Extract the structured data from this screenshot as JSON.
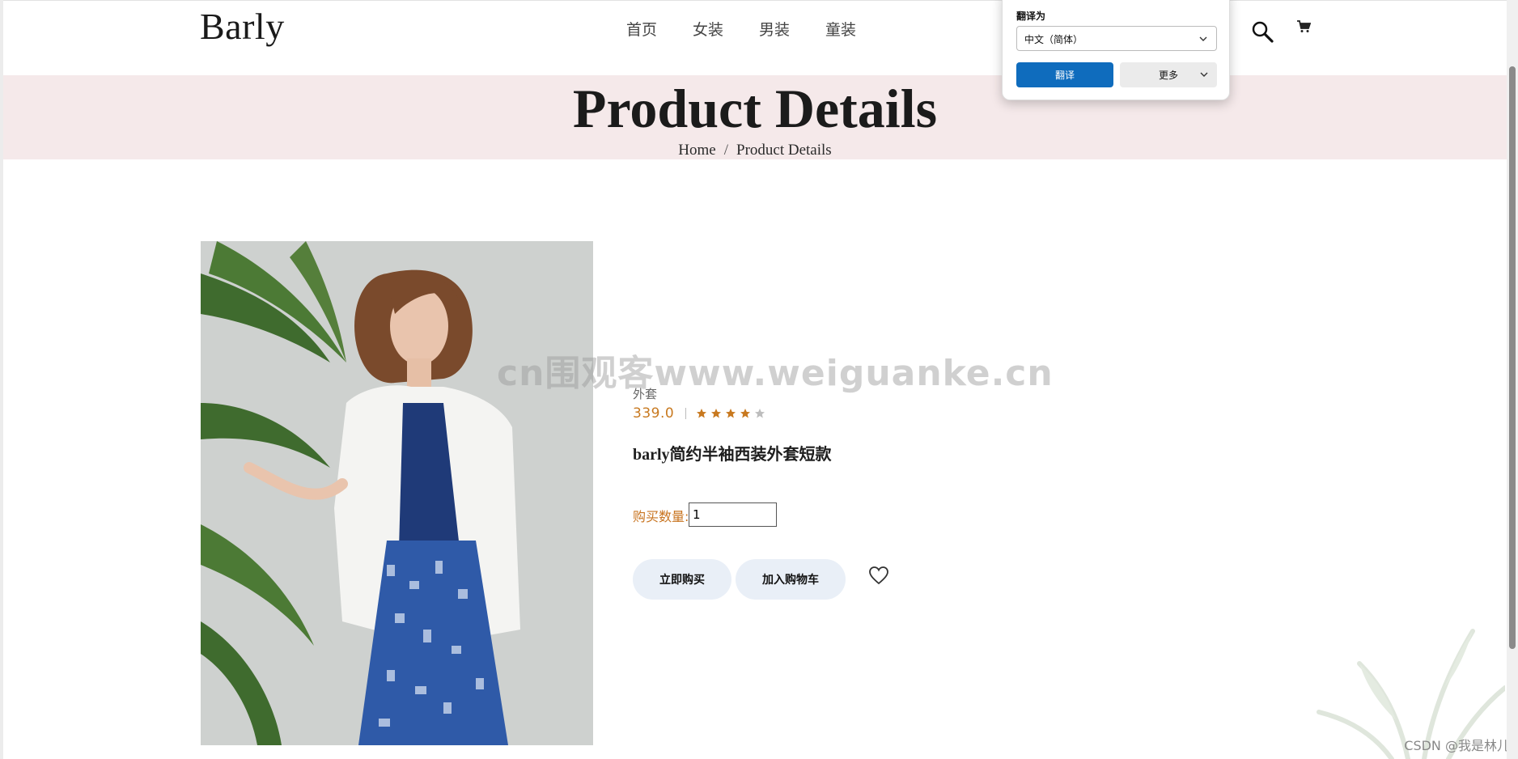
{
  "header": {
    "logo": "Barly",
    "nav": [
      {
        "label": "首页"
      },
      {
        "label": "女装"
      },
      {
        "label": "男装"
      },
      {
        "label": "童装"
      }
    ],
    "icons": [
      "search-icon",
      "cart-icon"
    ]
  },
  "banner": {
    "title": "Product Details",
    "breadcrumb": {
      "home": "Home",
      "separator": "/",
      "current": "Product Details"
    },
    "background": "#f5e9ea"
  },
  "product": {
    "category": "外套",
    "price": "339.0",
    "rating": 4,
    "rating_max": 5,
    "name": "barly简约半袖西装外套短款",
    "quantity_label": "购买数量:",
    "quantity_value": "1",
    "buy_now_label": "立即购买",
    "add_to_cart_label": "加入购物车",
    "accent_color": "#c8791f"
  },
  "translate_popup": {
    "label": "翻译为",
    "selected_language": "中文（简体）",
    "translate_button": "翻译",
    "more_button": "更多",
    "primary_color": "#0f6cbd"
  },
  "watermark": "cn围观客www.weiguanke.cn",
  "csdn_credit": "CSDN @我是林儿"
}
